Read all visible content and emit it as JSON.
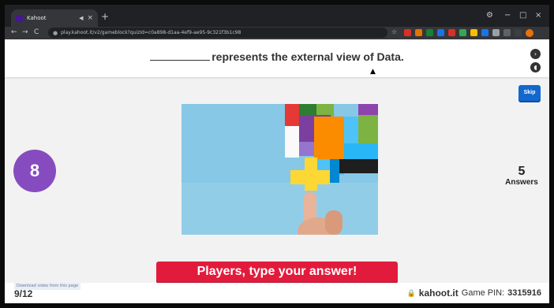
{
  "browser": {
    "tab_title": "Kahoot",
    "tab_audio_icon": "speaker-icon",
    "close_glyph": "×",
    "new_tab_glyph": "+",
    "url": "play.kahoot.it/v2/gameblock?quizId=c0a898-d1aa-4ef9-ae95-9c321f3b1c98",
    "window_controls": [
      "−",
      "□",
      "×"
    ],
    "nav_glyphs": [
      "←",
      "→",
      "C"
    ],
    "lock_glyph": "🔒",
    "extension_colors": [
      "#d93025",
      "#e37400",
      "#188038",
      "#1a73e8",
      "#d93025",
      "#34a853",
      "#fbbc04",
      "#1a73e8",
      "#9aa0a6"
    ]
  },
  "question": {
    "text": "represents the external view of Data.",
    "blank_label": ""
  },
  "controls": {
    "skip_label": "Skip",
    "next_glyph": "›",
    "sound_glyph": "◖"
  },
  "timer": {
    "value": "8",
    "color": "#864cbf"
  },
  "answers": {
    "count": "5",
    "label": "Answers"
  },
  "prompt": {
    "text": "Players, type your answer!",
    "color": "#e21b3c"
  },
  "footer": {
    "progress": "9/12",
    "download_bar": "Download video from this page",
    "site": "kahoot.it",
    "pin_label": "Game PIN:",
    "pin": "3315916"
  }
}
